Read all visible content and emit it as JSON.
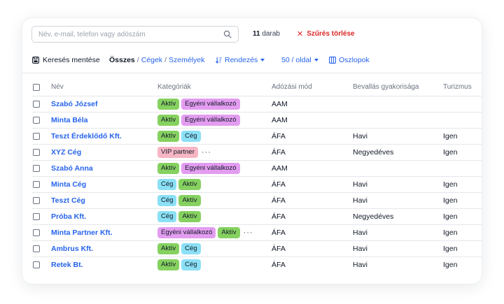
{
  "search": {
    "placeholder": "Név, e-mail, telefon vagy adószám",
    "value": ""
  },
  "result_count": {
    "number": "11",
    "unit": "darab"
  },
  "clear_filters_label": "Szűrés törlése",
  "toolbar": {
    "save_search_label": "Keresés mentése",
    "filter_all": "Összes",
    "filter_sep": "/",
    "filter_companies": "Cégek",
    "filter_persons": "Személyek",
    "sort_label": "Rendezés",
    "per_page_label": "50 / oldal",
    "columns_label": "Oszlopok"
  },
  "table": {
    "headers": {
      "name": "Név",
      "categories": "Kategóriák",
      "tax_mode": "Adózási mód",
      "filing_frequency": "Bevallás gyakorisága",
      "tourism": "Turizmus"
    },
    "tag_colors": {
      "Aktív": "#86d160",
      "Egyéni vállalkozó": "#e39df0",
      "Cég": "#8be0f5",
      "VIP partner": "#f7b6c4"
    },
    "rows": [
      {
        "name": "Szabó József",
        "tags": [
          "Aktív",
          "Egyéni vállalkozó"
        ],
        "more": false,
        "tax": "AAM",
        "freq": "",
        "tourism": ""
      },
      {
        "name": "Minta Béla",
        "tags": [
          "Aktív",
          "Egyéni vállalkozó"
        ],
        "more": false,
        "tax": "AAM",
        "freq": "",
        "tourism": ""
      },
      {
        "name": "Teszt Érdeklődő Kft.",
        "tags": [
          "Aktív",
          "Cég"
        ],
        "more": false,
        "tax": "ÁFA",
        "freq": "Havi",
        "tourism": "Igen"
      },
      {
        "name": "XYZ Cég",
        "tags": [
          "VIP partner"
        ],
        "more": true,
        "tax": "ÁFA",
        "freq": "Negyedéves",
        "tourism": "Igen"
      },
      {
        "name": "Szabó Anna",
        "tags": [
          "Aktív",
          "Egyéni vállalkozó"
        ],
        "more": false,
        "tax": "AAM",
        "freq": "",
        "tourism": ""
      },
      {
        "name": "Minta Cég",
        "tags": [
          "Cég",
          "Aktív"
        ],
        "more": false,
        "tax": "ÁFA",
        "freq": "Havi",
        "tourism": "Igen"
      },
      {
        "name": "Teszt Cég",
        "tags": [
          "Cég",
          "Aktív"
        ],
        "more": false,
        "tax": "ÁFA",
        "freq": "Havi",
        "tourism": "Igen"
      },
      {
        "name": "Próba Kft.",
        "tags": [
          "Cég",
          "Aktív"
        ],
        "more": false,
        "tax": "ÁFA",
        "freq": "Negyedéves",
        "tourism": "Igen"
      },
      {
        "name": "Minta Partner Kft.",
        "tags": [
          "Egyéni vállalkozó",
          "Aktív"
        ],
        "more": true,
        "tax": "ÁFA",
        "freq": "Havi",
        "tourism": "Igen"
      },
      {
        "name": "Ambrus Kft.",
        "tags": [
          "Aktív",
          "Cég"
        ],
        "more": false,
        "tax": "ÁFA",
        "freq": "Havi",
        "tourism": "Igen"
      },
      {
        "name": "Retek Bt.",
        "tags": [
          "Aktív",
          "Cég"
        ],
        "more": false,
        "tax": "ÁFA",
        "freq": "Havi",
        "tourism": "Igen"
      }
    ],
    "more_glyph": "···"
  }
}
